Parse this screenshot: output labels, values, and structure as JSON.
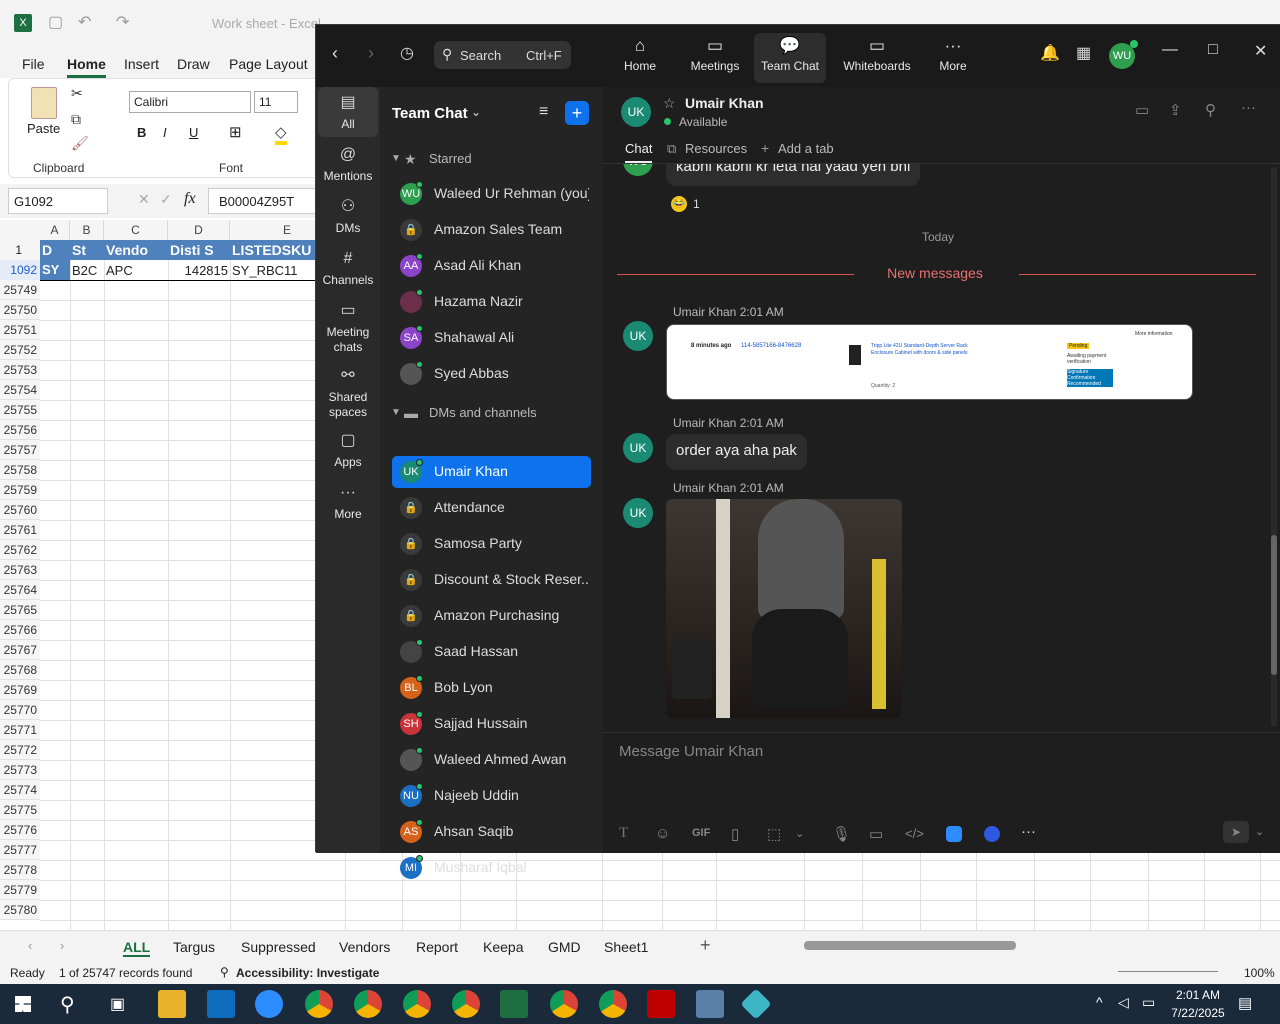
{
  "excel": {
    "title": "Work sheet - Excel",
    "tabs": [
      "File",
      "Home",
      "Insert",
      "Draw",
      "Page Layout"
    ],
    "paste": "Paste",
    "clipboard": "Clipboard",
    "font_group": "Font",
    "font_name": "Calibri",
    "font_size": "11",
    "name_box": "G1092",
    "formula": "B00004Z95T",
    "col_letters": [
      "A",
      "B",
      "C",
      "D",
      "E"
    ],
    "headers": [
      "D",
      "St",
      "Vendo",
      "Disti S",
      "LISTEDSKU"
    ],
    "data_row": {
      "num": "1092",
      "a": "SY",
      "b": "B2C",
      "c": "APC",
      "d": "142815",
      "e": "SY_RBC11"
    },
    "row1": "1",
    "rows": [
      "25749",
      "25750",
      "25751",
      "25752",
      "25753",
      "25754",
      "25755",
      "25756",
      "25757",
      "25758",
      "25759",
      "25760",
      "25761",
      "25762",
      "25763",
      "25764",
      "25765",
      "25766",
      "25767",
      "25768",
      "25769",
      "25770",
      "25771",
      "25772",
      "25773",
      "25774",
      "25775",
      "25776",
      "25777",
      "25778",
      "25779",
      "25780"
    ],
    "sheets": [
      "ALL",
      "Targus",
      "Suppressed",
      "Vendors",
      "Report",
      "Keepa",
      "GMD",
      "Sheet1"
    ],
    "status_ready": "Ready",
    "status_records": "1 of 25747 records found",
    "status_access": "Accessibility: Investigate",
    "zoom": "100%"
  },
  "zoom": {
    "search": "Search",
    "shortcut": "Ctrl+F",
    "nav": [
      {
        "label": "Home",
        "icon": "home-icon"
      },
      {
        "label": "Meetings",
        "icon": "video-icon"
      },
      {
        "label": "Team Chat",
        "icon": "chat-icon"
      },
      {
        "label": "Whiteboards",
        "icon": "whiteboard-icon"
      },
      {
        "label": "More",
        "icon": "more-icon"
      }
    ],
    "user_initials": "WU",
    "rail": [
      {
        "label": "All"
      },
      {
        "label": "Mentions"
      },
      {
        "label": "DMs"
      },
      {
        "label": "Channels"
      },
      {
        "label": "Meeting chats"
      },
      {
        "label": "Shared spaces"
      },
      {
        "label": "Apps"
      },
      {
        "label": "More"
      }
    ],
    "list_title": "Team Chat",
    "starred": "Starred",
    "dms_channels": "DMs and channels",
    "starred_items": [
      {
        "name": "Waleed Ur Rehman (you)",
        "initials": "WU",
        "color": "#2e9e4f"
      },
      {
        "name": "Amazon Sales Team",
        "initials": "",
        "color": "lock"
      },
      {
        "name": "Asad Ali Khan",
        "initials": "AA",
        "color": "#8b44c8"
      },
      {
        "name": "Hazama Nazir",
        "initials": "",
        "color": "#6b2f4a"
      },
      {
        "name": "Shahawal Ali",
        "initials": "SA",
        "color": "#8b44c8"
      },
      {
        "name": "Syed Abbas",
        "initials": "",
        "color": "#555"
      }
    ],
    "dm_items": [
      {
        "name": "Umair Khan",
        "initials": "UK",
        "color": "#1a8a73"
      },
      {
        "name": "Attendance",
        "initials": "",
        "color": "lock"
      },
      {
        "name": "Samosa Party",
        "initials": "",
        "color": "lock"
      },
      {
        "name": "Discount & Stock Reser...",
        "initials": "",
        "color": "lock"
      },
      {
        "name": "Amazon Purchasing",
        "initials": "",
        "color": "lock"
      },
      {
        "name": "Saad Hassan",
        "initials": "",
        "color": "#444"
      },
      {
        "name": "Bob Lyon",
        "initials": "BL",
        "color": "#d4621a"
      },
      {
        "name": "Sajjad Hussain",
        "initials": "SH",
        "color": "#c8343a"
      },
      {
        "name": "Waleed Ahmed Awan",
        "initials": "",
        "color": "#555"
      },
      {
        "name": "Najeeb Uddin",
        "initials": "NU",
        "color": "#1d6fc4"
      },
      {
        "name": "Ahsan Saqib",
        "initials": "AS",
        "color": "#d4621a"
      },
      {
        "name": "Musharaf Iqbal",
        "initials": "MI",
        "color": "#1d6fc4"
      }
    ],
    "chat": {
      "contact": "Umair Khan",
      "initials": "UK",
      "presence": "Available",
      "tabs": [
        "Chat",
        "Resources",
        "Add a tab"
      ],
      "prev_msg": "kabhi kabhi kr leta hai yaad yeh bhi",
      "prev_initials": "WU",
      "reaction": "1",
      "reaction_icon": "laugh-emoji-icon",
      "today": "Today",
      "new_messages": "New messages",
      "messages": [
        {
          "sender": "Umair Khan",
          "time": "2:01 AM",
          "type": "image"
        },
        {
          "sender": "Umair Khan",
          "time": "2:01 AM",
          "type": "text",
          "text": "order aya aha pak"
        },
        {
          "sender": "Umair Khan",
          "time": "2:01 AM",
          "type": "photo"
        }
      ],
      "screenshot": {
        "ago": "8 minutes ago",
        "order": "114-5857166-8476628",
        "desc": "Tripp Lite 42U Standard-Depth Server Rack Enclosure Cabinet with doors & side panels",
        "qty": "Quantity: 2",
        "more_info": "More information",
        "status": "Pending",
        "status2": "Awaiting payment verification",
        "sig": "Signature Confirmation Recommended"
      },
      "placeholder": "Message Umair Khan"
    }
  },
  "taskbar": {
    "time": "2:01 AM",
    "date": "7/22/2025"
  }
}
